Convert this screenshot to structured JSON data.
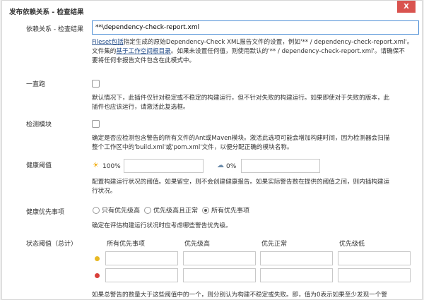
{
  "panel": {
    "title": "发布依赖关系 - 检查结果",
    "close_label": "X"
  },
  "dependency_results": {
    "label": "依赖关系 - 检查结果",
    "value": "**\\dependency-check-report.xml",
    "help_link_fileset": "Fileset包括",
    "help_text_1": "指定生成的原始Dependency-Check XML报告文件的设置，例如'** / dependency-check-report.xml'。",
    "help_text_2a": "文件集的",
    "help_link_workspace": "基于工作空间根目录",
    "help_text_2b": "。如果未设置任何值，则使用默认的'** / dependency-check-report.xml'。请确保不",
    "help_text_3": "要将任何非报告文件包含在此模式中。"
  },
  "run_always": {
    "label": "一直跑",
    "help_line_1": "默认情况下，此插件仅针对稳定或不稳定的构建运行，但不针对失败的构建运行。如果即使对于失败的版本，此",
    "help_line_2": "插件也应该运行，请激活此复选框。"
  },
  "detect_modules": {
    "label": "检测模块",
    "help_line_1": "确定是否应检测包含警告的所有文件的Ant或Maven模块。激活此选项可能会增加构建时间，因为检测器会扫描",
    "help_line_2": "整个工作区中的'build.xml'或'pom.xml'文件，以便分配正确的模块名称。"
  },
  "health": {
    "label": "健康阈值",
    "sunny_value": "100%",
    "stormy_value": "0%",
    "help_line_1": "配置构建运行状况的阈值。如果留空，则不会创建健康报告。如果实际警告数在提供的阈值之间，则内插构建运",
    "help_line_2": "行状况。"
  },
  "health_priority": {
    "label": "健康优先事项",
    "options": [
      "只有优先级高",
      "优先级高且正常",
      "所有优先事项"
    ],
    "selected_index": 2,
    "help": "确定在评估构建运行状况时应考虑哪些警告优先级。"
  },
  "status_thresholds": {
    "label": "状态阈值（总计）",
    "columns": [
      "所有优先事项",
      "优先级高",
      "优先正常",
      "优先级低"
    ],
    "colors": {
      "unstable": "#e8b923",
      "failed": "#d9403a"
    },
    "help": "如果总警告的数量大于这些阈值中的一个，则分别认为构建不稳定或失败。即，值为0表示如果至少发现一个警"
  }
}
